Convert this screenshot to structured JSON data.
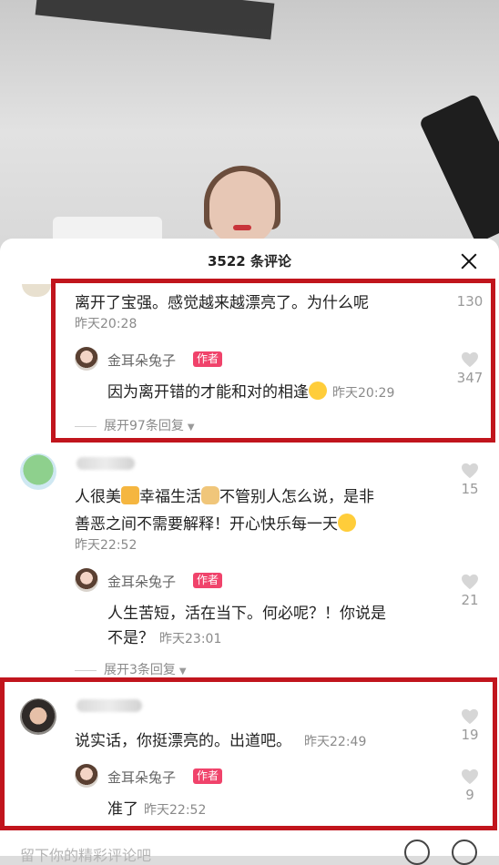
{
  "header": {
    "title": "3522 条评论"
  },
  "comments": [
    {
      "text": "离开了宝强。感觉越来越漂亮了。为什么呢",
      "time": "昨天20:28",
      "likes": "130",
      "reply": {
        "author": "金耳朵兔子",
        "badge": "作者",
        "text": "因为离开错的才能和对的相逢",
        "time": "昨天20:29",
        "likes": "347"
      },
      "expand": "展开97条回复"
    },
    {
      "line1": "人很美",
      "line1b": "幸福生活",
      "line1c": "不管别人怎么说，是非",
      "line2": "善恶之间不需要解释！开心快乐每一天",
      "time": "昨天22:52",
      "likes": "15",
      "reply": {
        "author": "金耳朵兔子",
        "badge": "作者",
        "line1": "人生苦短，活在当下。何必呢？！你说是",
        "line2": "不是？",
        "time": "昨天23:01",
        "likes": "21"
      },
      "expand": "展开3条回复"
    },
    {
      "text": "说实话，你挺漂亮的。出道吧。",
      "time": "昨天22:49",
      "likes": "19",
      "reply": {
        "author": "金耳朵兔子",
        "badge": "作者",
        "text": "准了",
        "time": "昨天22:52",
        "likes": "9"
      }
    }
  ],
  "input": {
    "placeholder": "留下你的精彩评论吧"
  },
  "colors": {
    "highlight": "#c1151d",
    "badge": "#f0436b"
  },
  "icons": [
    "close-icon",
    "heart-icon",
    "chevron-down-icon",
    "at-icon",
    "emoji-icon"
  ]
}
